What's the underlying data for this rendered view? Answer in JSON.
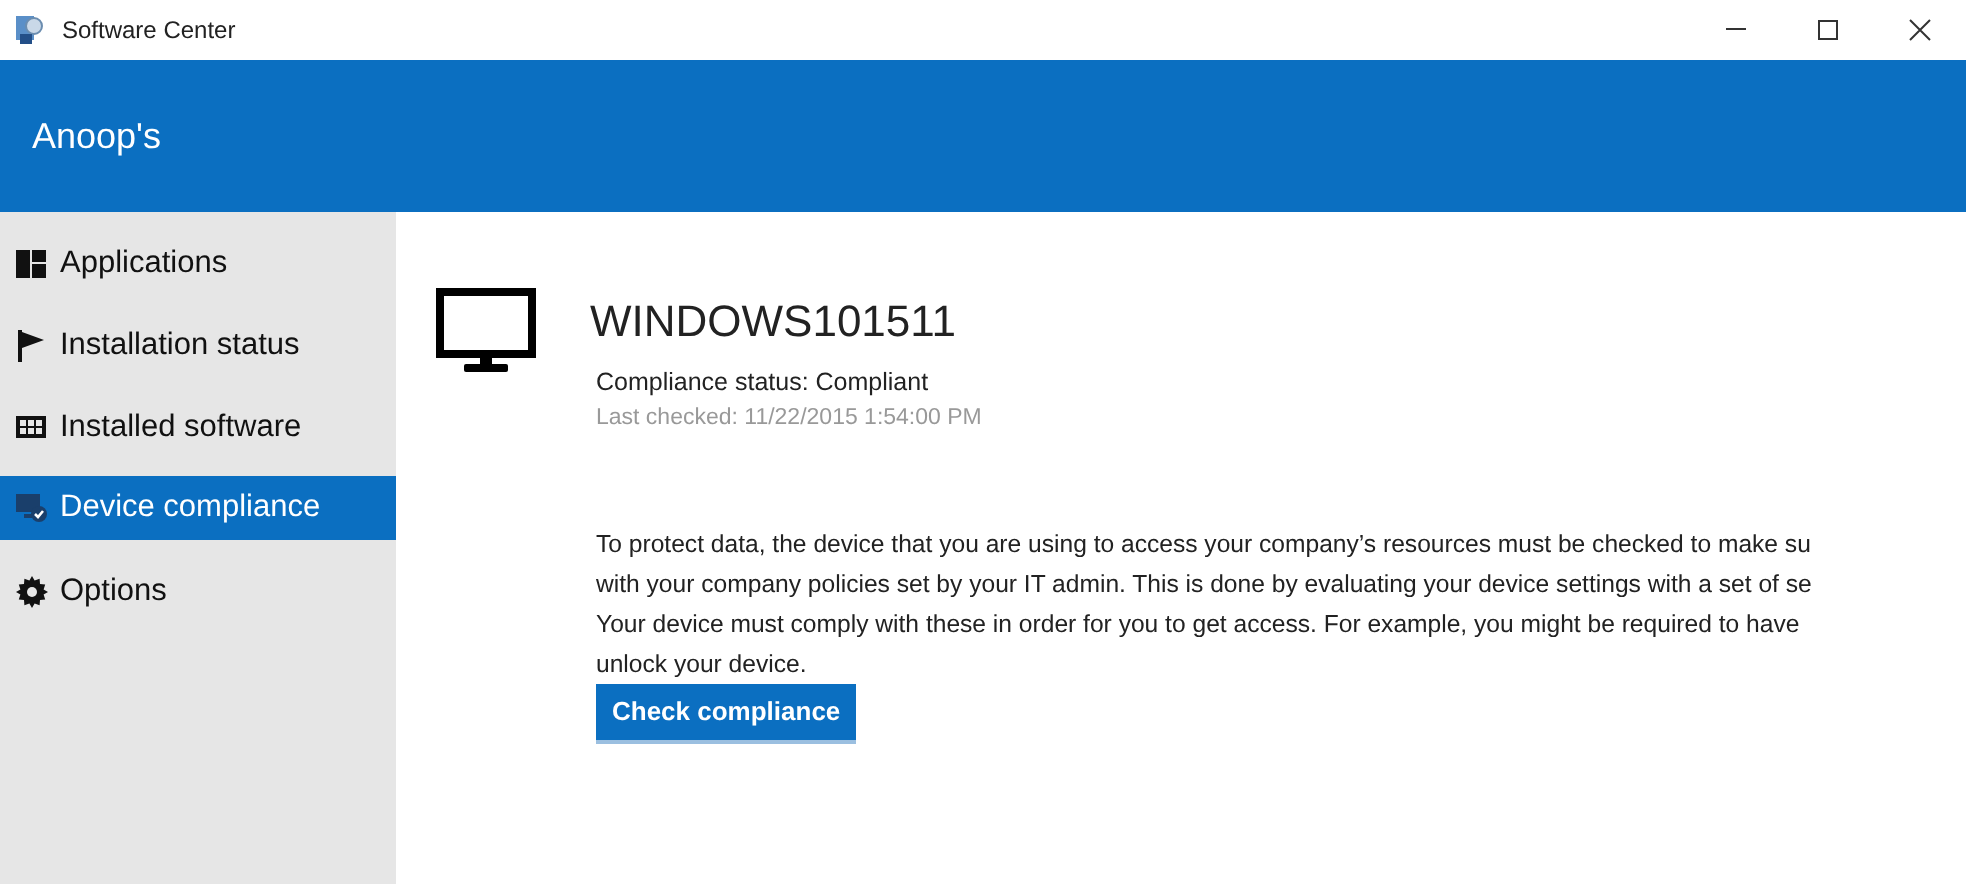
{
  "window": {
    "title": "Software Center"
  },
  "header": {
    "title": "Anoop's"
  },
  "sidebar": {
    "items": [
      {
        "kind": "applications",
        "label": "Applications",
        "selected": false
      },
      {
        "kind": "status",
        "label": "Installation status",
        "selected": false
      },
      {
        "kind": "installed",
        "label": "Installed software",
        "selected": false
      },
      {
        "kind": "compliance",
        "label": "Device compliance",
        "selected": true
      },
      {
        "kind": "options",
        "label": "Options",
        "selected": false
      }
    ]
  },
  "device": {
    "name": "WINDOWS101511",
    "status": "Compliance status: Compliant",
    "last_checked": "Last checked: 11/22/2015 1:54:00 PM"
  },
  "description": [
    "To protect data, the device that you are using to access your company’s resources must be checked to make su",
    "with your company policies set by your IT admin. This is done by evaluating your device settings with a set of se",
    "Your device must comply with these in order for you to get access. For example, you might be required to have",
    "unlock your device."
  ],
  "button": {
    "label": "Check compliance"
  }
}
